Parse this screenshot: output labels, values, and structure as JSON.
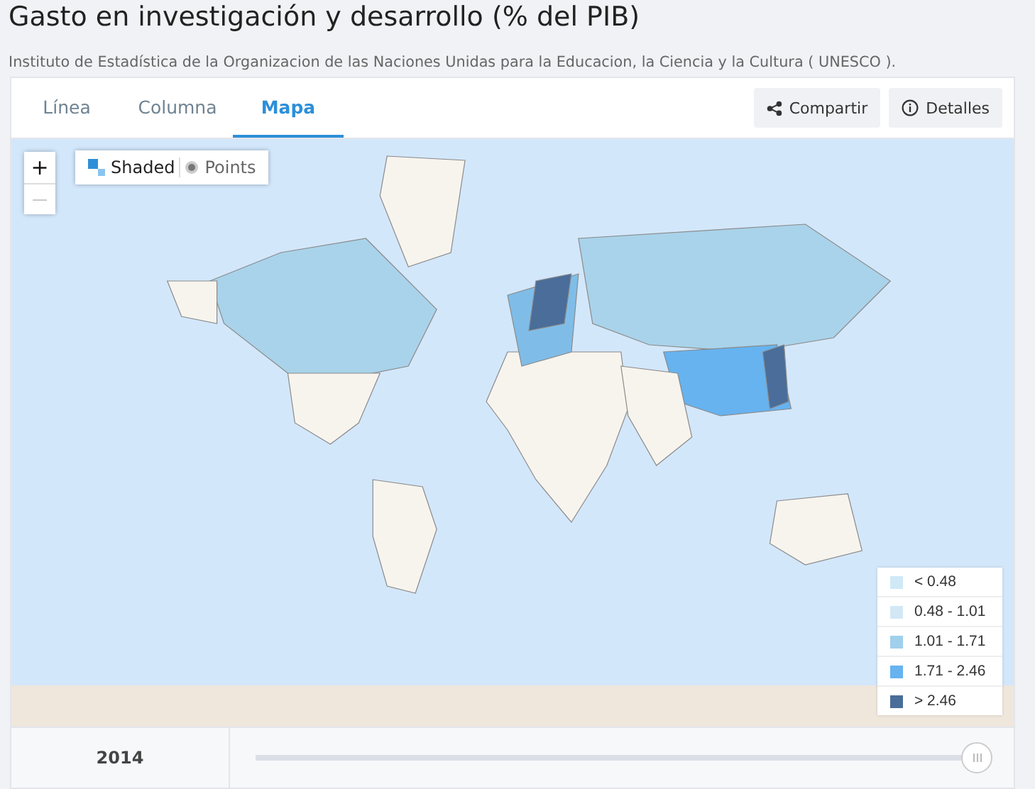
{
  "title": "Gasto en investigación y desarrollo (% del PIB)",
  "source": "Instituto de Estadística de la Organizacion de las Naciones Unidas para la Educacion, la Ciencia y la Cultura ( UNESCO ).",
  "tabs": [
    {
      "label": "Línea",
      "selected": false
    },
    {
      "label": "Columna",
      "selected": false
    },
    {
      "label": "Mapa",
      "selected": true
    }
  ],
  "actions": [
    {
      "label": "Compartir",
      "kind": "share"
    },
    {
      "label": "Detalles",
      "kind": "info"
    }
  ],
  "zoom": {
    "in": "+",
    "out": "—"
  },
  "map_modes": [
    {
      "label": "Shaded",
      "kind": "shaded",
      "selected": true
    },
    {
      "label": "Points",
      "kind": "points",
      "selected": false
    }
  ],
  "legend": [
    {
      "label": "< 0.48",
      "color": "#cfe9f7"
    },
    {
      "label": "0.48 - 1.01",
      "color": "#d2e8f5"
    },
    {
      "label": "1.01 - 1.71",
      "color": "#9fd0ec"
    },
    {
      "label": "1.71 - 2.46",
      "color": "#66b3f0"
    },
    {
      "label": "> 2.46",
      "color": "#4a6d99"
    }
  ],
  "timeline": {
    "year": "2014",
    "level": 1
  }
}
